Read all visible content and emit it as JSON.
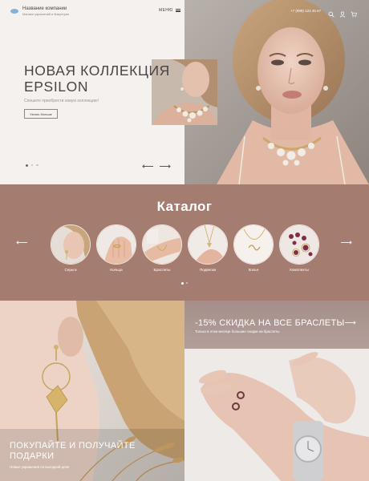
{
  "brand": {
    "name": "Название компании",
    "tagline": "Магазин украшений и бижутерии",
    "logo_icon": "wave-logo-icon"
  },
  "header": {
    "menu_label": "МЕНЮ",
    "phone": "+7 (999) 123 45 67",
    "icons": [
      "search-icon",
      "user-icon",
      "cart-icon"
    ]
  },
  "hero": {
    "title_line1": "НОВАЯ КОЛЛЕКЦИЯ",
    "title_line2": "EPSILON",
    "subtitle": "Спешите приобрести новую коллекцию!",
    "button_label": "Узнать больше",
    "slide_count": 3,
    "active_slide": 1
  },
  "catalog": {
    "title": "Каталог",
    "items": [
      {
        "label": "Серьги"
      },
      {
        "label": "Кольца"
      },
      {
        "label": "Браслеты"
      },
      {
        "label": "Подвески"
      },
      {
        "label": "Колье"
      },
      {
        "label": "Комплекты"
      }
    ],
    "page_count": 2,
    "active_page": 1
  },
  "promo_left": {
    "title_line1": "ПОКУПАЙТЕ И ПОЛУЧАЙТЕ",
    "title_line2": "ПОДАРКИ",
    "subtitle": "Новые украшения по выгодной цене"
  },
  "promo_right": {
    "title": "-15% СКИДКА НА ВСЕ БРАСЛЕТЫ",
    "subtitle": "Только в этом месяце большие скидки на браслеты"
  },
  "colors": {
    "catalog_bg": "#a57d70",
    "hero_bg": "#f5f1ee",
    "text_dark": "#4a4442"
  }
}
